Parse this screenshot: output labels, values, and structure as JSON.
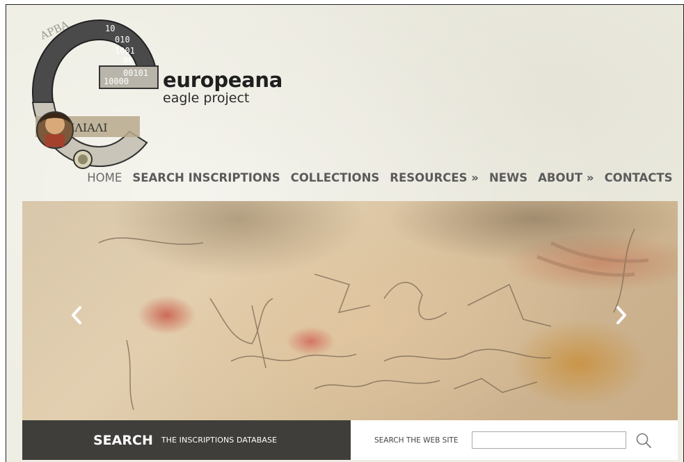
{
  "brand": {
    "name": "europeana",
    "subtitle": "eagle project",
    "logo_digits": [
      "10",
      "010",
      "1001",
      "00",
      "00101",
      "10000"
    ]
  },
  "nav": [
    {
      "label": "HOME"
    },
    {
      "label": "SEARCH INSCRIPTIONS"
    },
    {
      "label": "COLLECTIONS"
    },
    {
      "label": "RESOURCES »"
    },
    {
      "label": "NEWS"
    },
    {
      "label": "ABOUT »"
    },
    {
      "label": "CONTACTS"
    }
  ],
  "slider": {
    "prev_icon": "chevron-left-icon",
    "next_icon": "chevron-right-icon"
  },
  "search": {
    "title": "SEARCH",
    "subtitle": "THE INSCRIPTIONS DATABASE",
    "site_label": "SEARCH THE WEB SITE",
    "site_input_value": "",
    "icon": "search-icon"
  },
  "colors": {
    "page_bg": "#efeee4",
    "nav_text": "#5b5b5b",
    "search_dark": "#3f3e3b"
  }
}
